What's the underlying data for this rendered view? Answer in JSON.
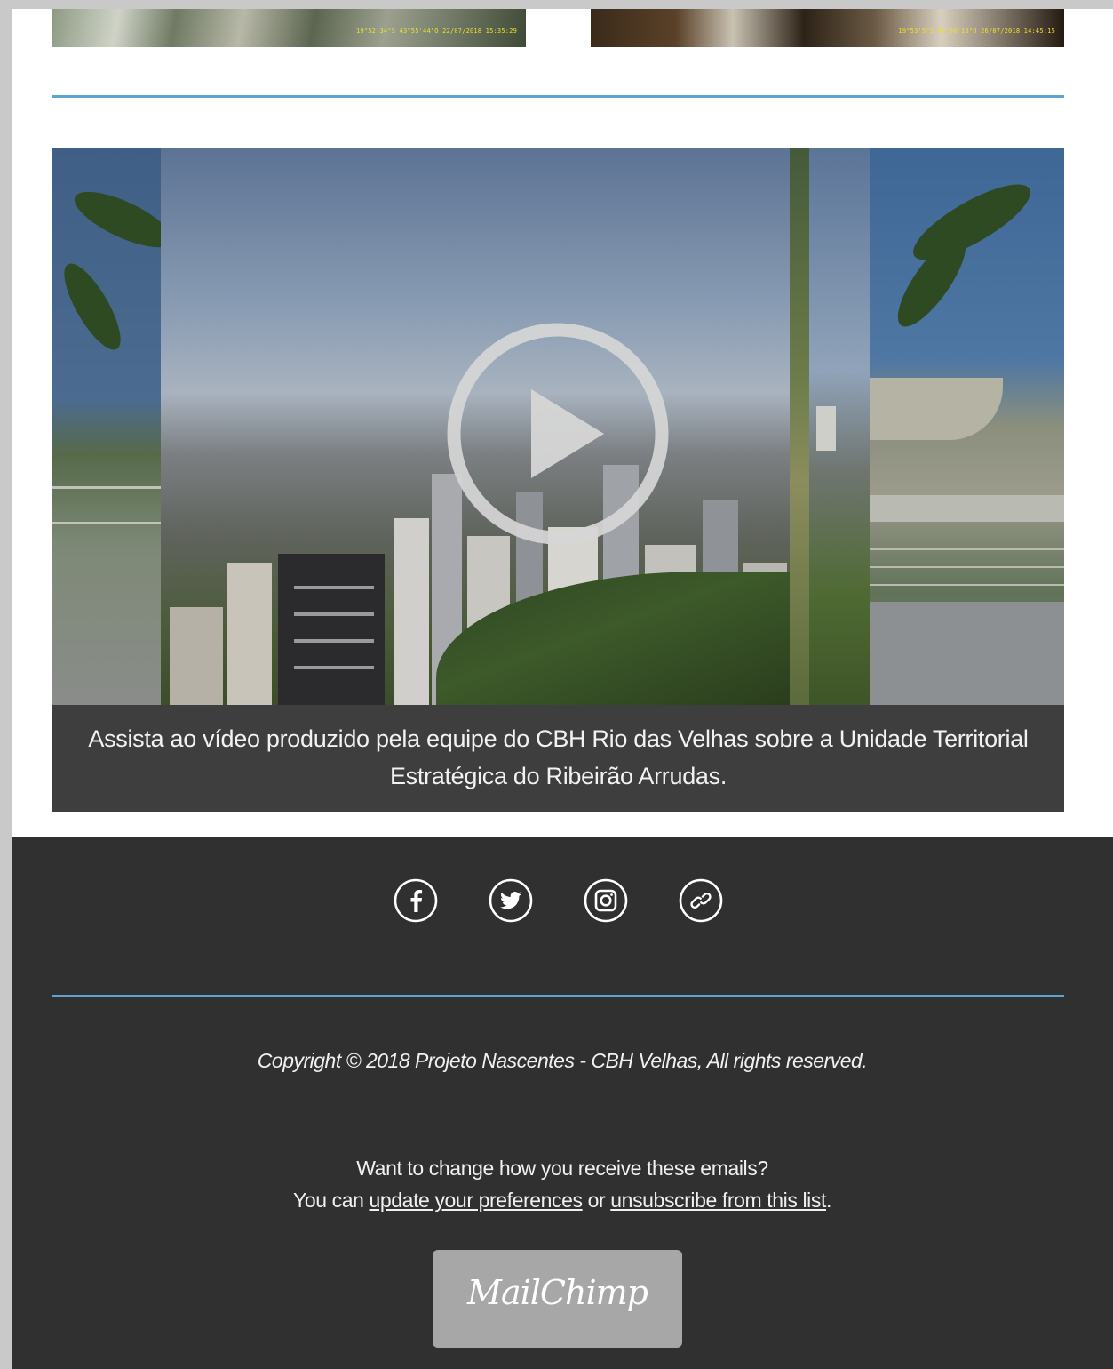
{
  "thumbnails": {
    "left_stamp": "19°52'34\"S  43°55'44\"O  22/07/2018 15:35:29",
    "right_stamp": "19°53'5\"S  43°56'13\"O  26/07/2018 14:45:15"
  },
  "video": {
    "caption": "Assista ao vídeo produzido pela equipe do CBH Rio das Velhas sobre a Unidade Territorial Estratégica do Ribeirão Arrudas."
  },
  "footer": {
    "social": [
      {
        "icon": "facebook-icon"
      },
      {
        "icon": "twitter-icon"
      },
      {
        "icon": "instagram-icon"
      },
      {
        "icon": "link-icon"
      }
    ],
    "copyright": "Copyright © 2018 Projeto Nascentes - CBH Velhas, All rights reserved.",
    "prefs_line1": "Want to change how you receive these emails?",
    "prefs_you_can": "You can ",
    "prefs_update_link": "update your preferences",
    "prefs_or": " or ",
    "prefs_unsubscribe_link": "unsubscribe from this list",
    "prefs_period": ".",
    "mailchimp_label": "MailChimp"
  },
  "colors": {
    "divider": "#5aa6cf",
    "footer_bg": "#303030",
    "caption_bg": "#3e3e3e"
  }
}
